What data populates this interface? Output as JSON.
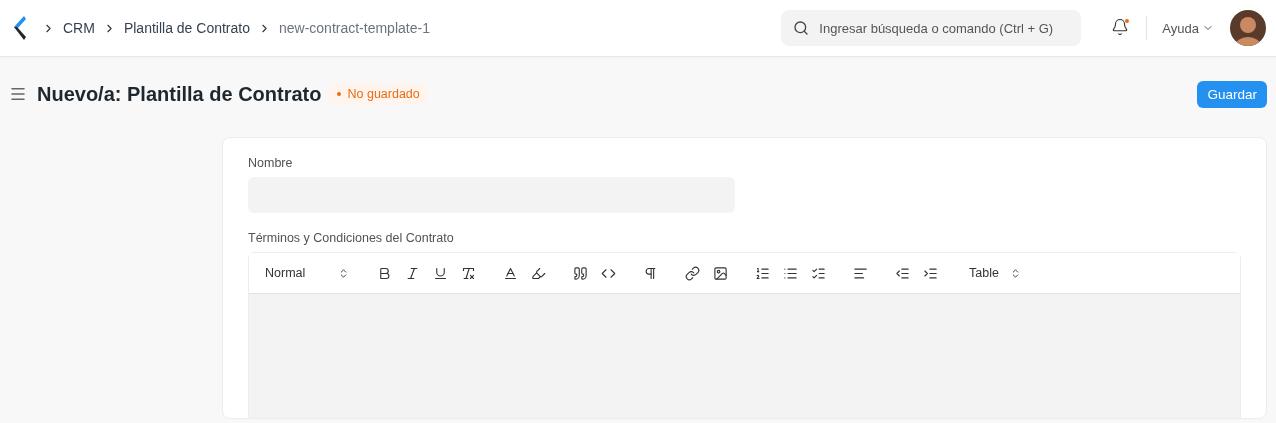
{
  "breadcrumbs": [
    "CRM",
    "Plantilla de Contrato",
    "new-contract-template-1"
  ],
  "search": {
    "placeholder": "Ingresar búsqueda o comando (Ctrl + G)"
  },
  "notifications": {
    "unread": true
  },
  "help_menu": {
    "label": "Ayuda"
  },
  "page": {
    "title": "Nuevo/a: Plantilla de Contrato",
    "status": "No guardado",
    "save_button": "Guardar"
  },
  "form": {
    "fields": [
      {
        "kind": "text",
        "label": "Nombre"
      },
      {
        "kind": "editor",
        "label": "Términos y Condiciones del Contrato",
        "format_select": "Normal",
        "table_select": "Table"
      }
    ]
  }
}
